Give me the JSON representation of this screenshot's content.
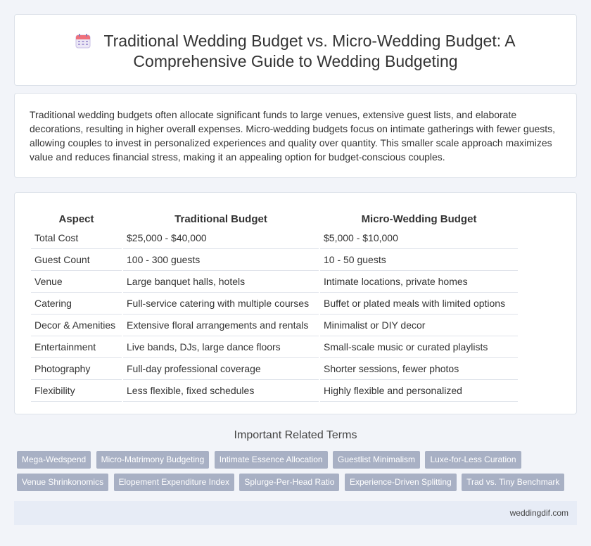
{
  "header": {
    "icon": "calendar-icon",
    "title_line1": "Traditional Wedding Budget vs. Micro-Wedding Budget: A",
    "title_line2": "Comprehensive Guide to Wedding Budgeting"
  },
  "intro": {
    "text": "Traditional wedding budgets often allocate significant funds to large venues, extensive guest lists, and elaborate decorations, resulting in higher overall expenses. Micro-wedding budgets focus on intimate gatherings with fewer guests, allowing couples to invest in personalized experiences and quality over quantity. This smaller scale approach maximizes value and reduces financial stress, making it an appealing option for budget-conscious couples."
  },
  "table": {
    "headers": [
      "Aspect",
      "Traditional Budget",
      "Micro-Wedding Budget"
    ],
    "rows": [
      [
        "Total Cost",
        "$25,000 - $40,000",
        "$5,000 - $10,000"
      ],
      [
        "Guest Count",
        "100 - 300 guests",
        "10 - 50 guests"
      ],
      [
        "Venue",
        "Large banquet halls, hotels",
        "Intimate locations, private homes"
      ],
      [
        "Catering",
        "Full-service catering with multiple courses",
        "Buffet or plated meals with limited options"
      ],
      [
        "Decor & Amenities",
        "Extensive floral arrangements and rentals",
        "Minimalist or DIY decor"
      ],
      [
        "Entertainment",
        "Live bands, DJs, large dance floors",
        "Small-scale music or curated playlists"
      ],
      [
        "Photography",
        "Full-day professional coverage",
        "Shorter sessions, fewer photos"
      ],
      [
        "Flexibility",
        "Less flexible, fixed schedules",
        "Highly flexible and personalized"
      ]
    ]
  },
  "related": {
    "title": "Important Related Terms",
    "row1": [
      "Mega-Wedspend",
      "Micro-Matrimony Budgeting",
      "Intimate Essence Allocation",
      "Guestlist Minimalism",
      "Luxe-for-Less Curation"
    ],
    "row2": [
      "Venue Shrinkonomics",
      "Elopement Expenditure Index",
      "Splurge-Per-Head Ratio",
      "Experience-Driven Splitting",
      "Trad vs. Tiny Benchmark"
    ]
  },
  "footer": {
    "site": "weddingdif.com"
  },
  "colors": {
    "tag_bg": "#a8b0c4",
    "footer_bg": "#e7ecf6",
    "page_bg": "#f2f4f9"
  }
}
